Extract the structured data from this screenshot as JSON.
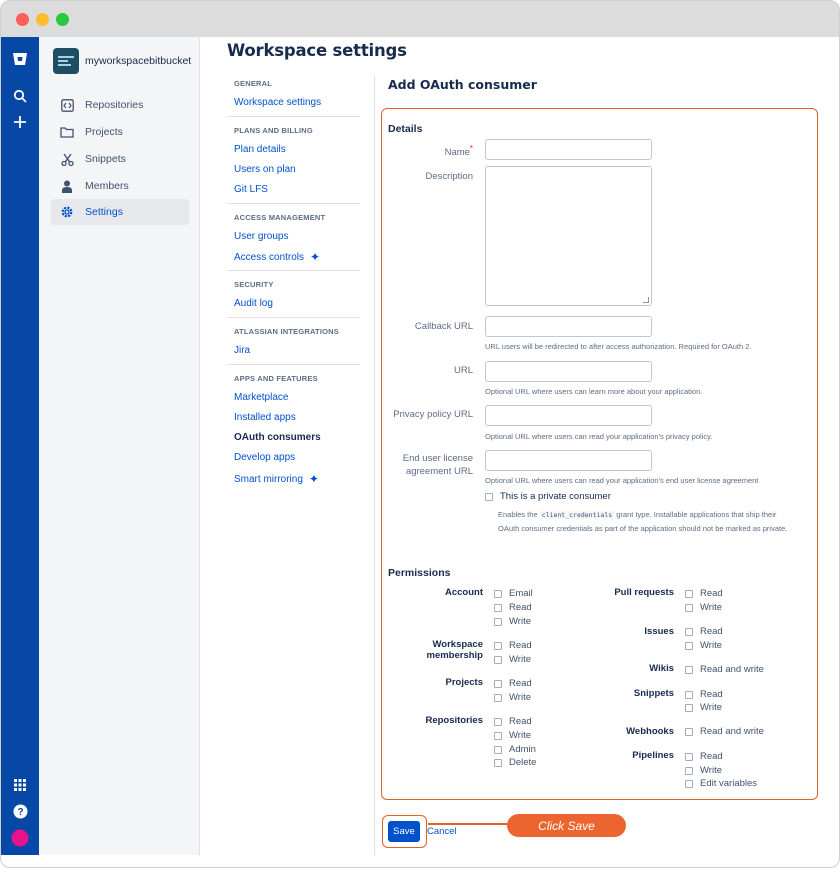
{
  "window": {
    "controls": [
      "close",
      "minimize",
      "maximize"
    ]
  },
  "rail": {
    "icons": [
      "bitbucket-logo-icon",
      "search-icon",
      "create-icon",
      "apps-grid-icon",
      "help-icon",
      "avatar"
    ]
  },
  "sidebar": {
    "workspace_name": "myworkspacebitbucket",
    "items": [
      {
        "label": "Repositories",
        "icon": "repositories-icon"
      },
      {
        "label": "Projects",
        "icon": "folder-icon"
      },
      {
        "label": "Snippets",
        "icon": "scissors-icon"
      },
      {
        "label": "Members",
        "icon": "person-icon"
      },
      {
        "label": "Settings",
        "icon": "gear-icon",
        "active": true
      }
    ]
  },
  "page": {
    "title": "Workspace settings"
  },
  "subnav": {
    "general": "GENERAL",
    "workspace_settings": "Workspace settings",
    "plans_billing": "PLANS AND BILLING",
    "plan_details": "Plan details",
    "users_on_plan": "Users on plan",
    "git_lfs": "Git LFS",
    "access_management": "ACCESS MANAGEMENT",
    "user_groups": "User groups",
    "access_controls": "Access controls",
    "security": "SECURITY",
    "audit_log": "Audit log",
    "atlassian_integrations": "ATLASSIAN INTEGRATIONS",
    "jira": "Jira",
    "apps_features": "APPS AND FEATURES",
    "marketplace": "Marketplace",
    "installed_apps": "Installed apps",
    "oauth_consumers": "OAuth consumers",
    "develop_apps": "Develop apps",
    "smart_mirroring": "Smart mirroring"
  },
  "form": {
    "title": "Add OAuth consumer",
    "details_heading": "Details",
    "name_label": "Name",
    "name_required": "*",
    "name_value": "",
    "description_label": "Description",
    "callback_label": "Callback URL",
    "callback_help": "URL users will be redirected to after access authorization. Required for OAuth 2.",
    "url_label": "URL",
    "url_help": "Optional URL where users can learn more about your application.",
    "privacy_label": "Privacy policy URL",
    "privacy_help": "Optional URL where users can read your application's privacy policy.",
    "eula_label_1": "End user license",
    "eula_label_2": "agreement URL",
    "eula_help": "Optional URL where users can read your application's end user license agreement",
    "private_label": "This is a private consumer",
    "private_help_1": "Enables the",
    "private_help_code": "client_credentials",
    "private_help_2": "grant type. Installable applications that ship their OAuth consumer credentials as part of the application should not be marked as private."
  },
  "permissions": {
    "heading": "Permissions",
    "account": {
      "label": "Account",
      "options": [
        "Email",
        "Read",
        "Write"
      ]
    },
    "workspace_membership": {
      "label_1": "Workspace",
      "label_2": "membership",
      "options": [
        "Read",
        "Write"
      ]
    },
    "projects": {
      "label": "Projects",
      "options": [
        "Read",
        "Write"
      ]
    },
    "repositories": {
      "label": "Repositories",
      "options": [
        "Read",
        "Write",
        "Admin",
        "Delete"
      ]
    },
    "pull_requests": {
      "label": "Pull requests",
      "options": [
        "Read",
        "Write"
      ]
    },
    "issues": {
      "label": "Issues",
      "options": [
        "Read",
        "Write"
      ]
    },
    "wikis": {
      "label": "Wikis",
      "options": [
        "Read and write"
      ]
    },
    "snippets": {
      "label": "Snippets",
      "options": [
        "Read",
        "Write"
      ]
    },
    "webhooks": {
      "label": "Webhooks",
      "options": [
        "Read and write"
      ]
    },
    "pipelines": {
      "label": "Pipelines",
      "options": [
        "Read",
        "Write",
        "Edit variables"
      ]
    }
  },
  "actions": {
    "save": "Save",
    "cancel": "Cancel"
  },
  "annotation": {
    "callout": "Click Save",
    "color": "#ec6530"
  },
  "colors": {
    "brand_blue": "#0747a6",
    "link_blue": "#0052cc",
    "highlight_orange": "#e2622b"
  }
}
